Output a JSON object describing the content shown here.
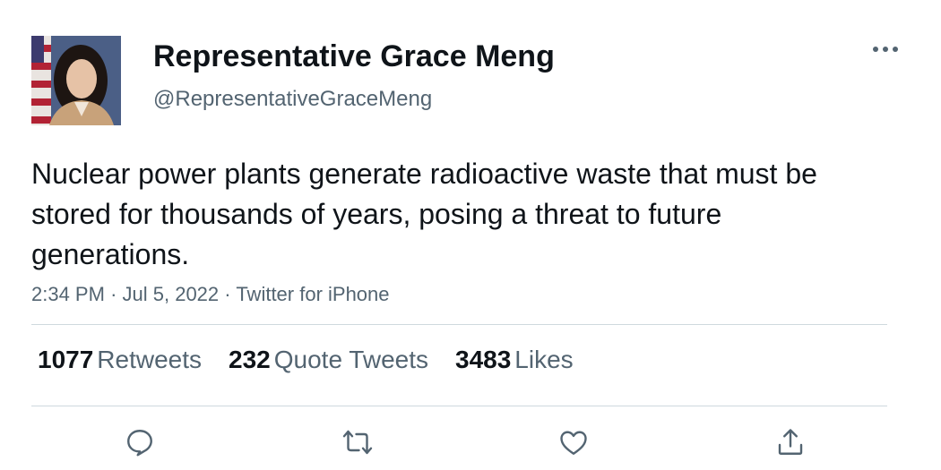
{
  "author": {
    "name": "Representative Grace Meng",
    "handle": "@RepresentativeGraceMeng"
  },
  "tweet": {
    "text": "Nuclear power plants generate radioactive waste that must be stored for thousands of years, posing a threat to future generations.",
    "time": "2:34 PM",
    "date": "Jul 5, 2022",
    "source": "Twitter for iPhone"
  },
  "stats": {
    "retweets_count": "1077",
    "retweets_label": "Retweets",
    "quotes_count": "232",
    "quotes_label": "Quote Tweets",
    "likes_count": "3483",
    "likes_label": "Likes"
  },
  "actions": [
    "reply-icon",
    "retweet-icon",
    "like-icon",
    "share-icon"
  ],
  "colors": {
    "text": "#0f1419",
    "secondary": "#536471",
    "divider": "#cfd9de"
  }
}
